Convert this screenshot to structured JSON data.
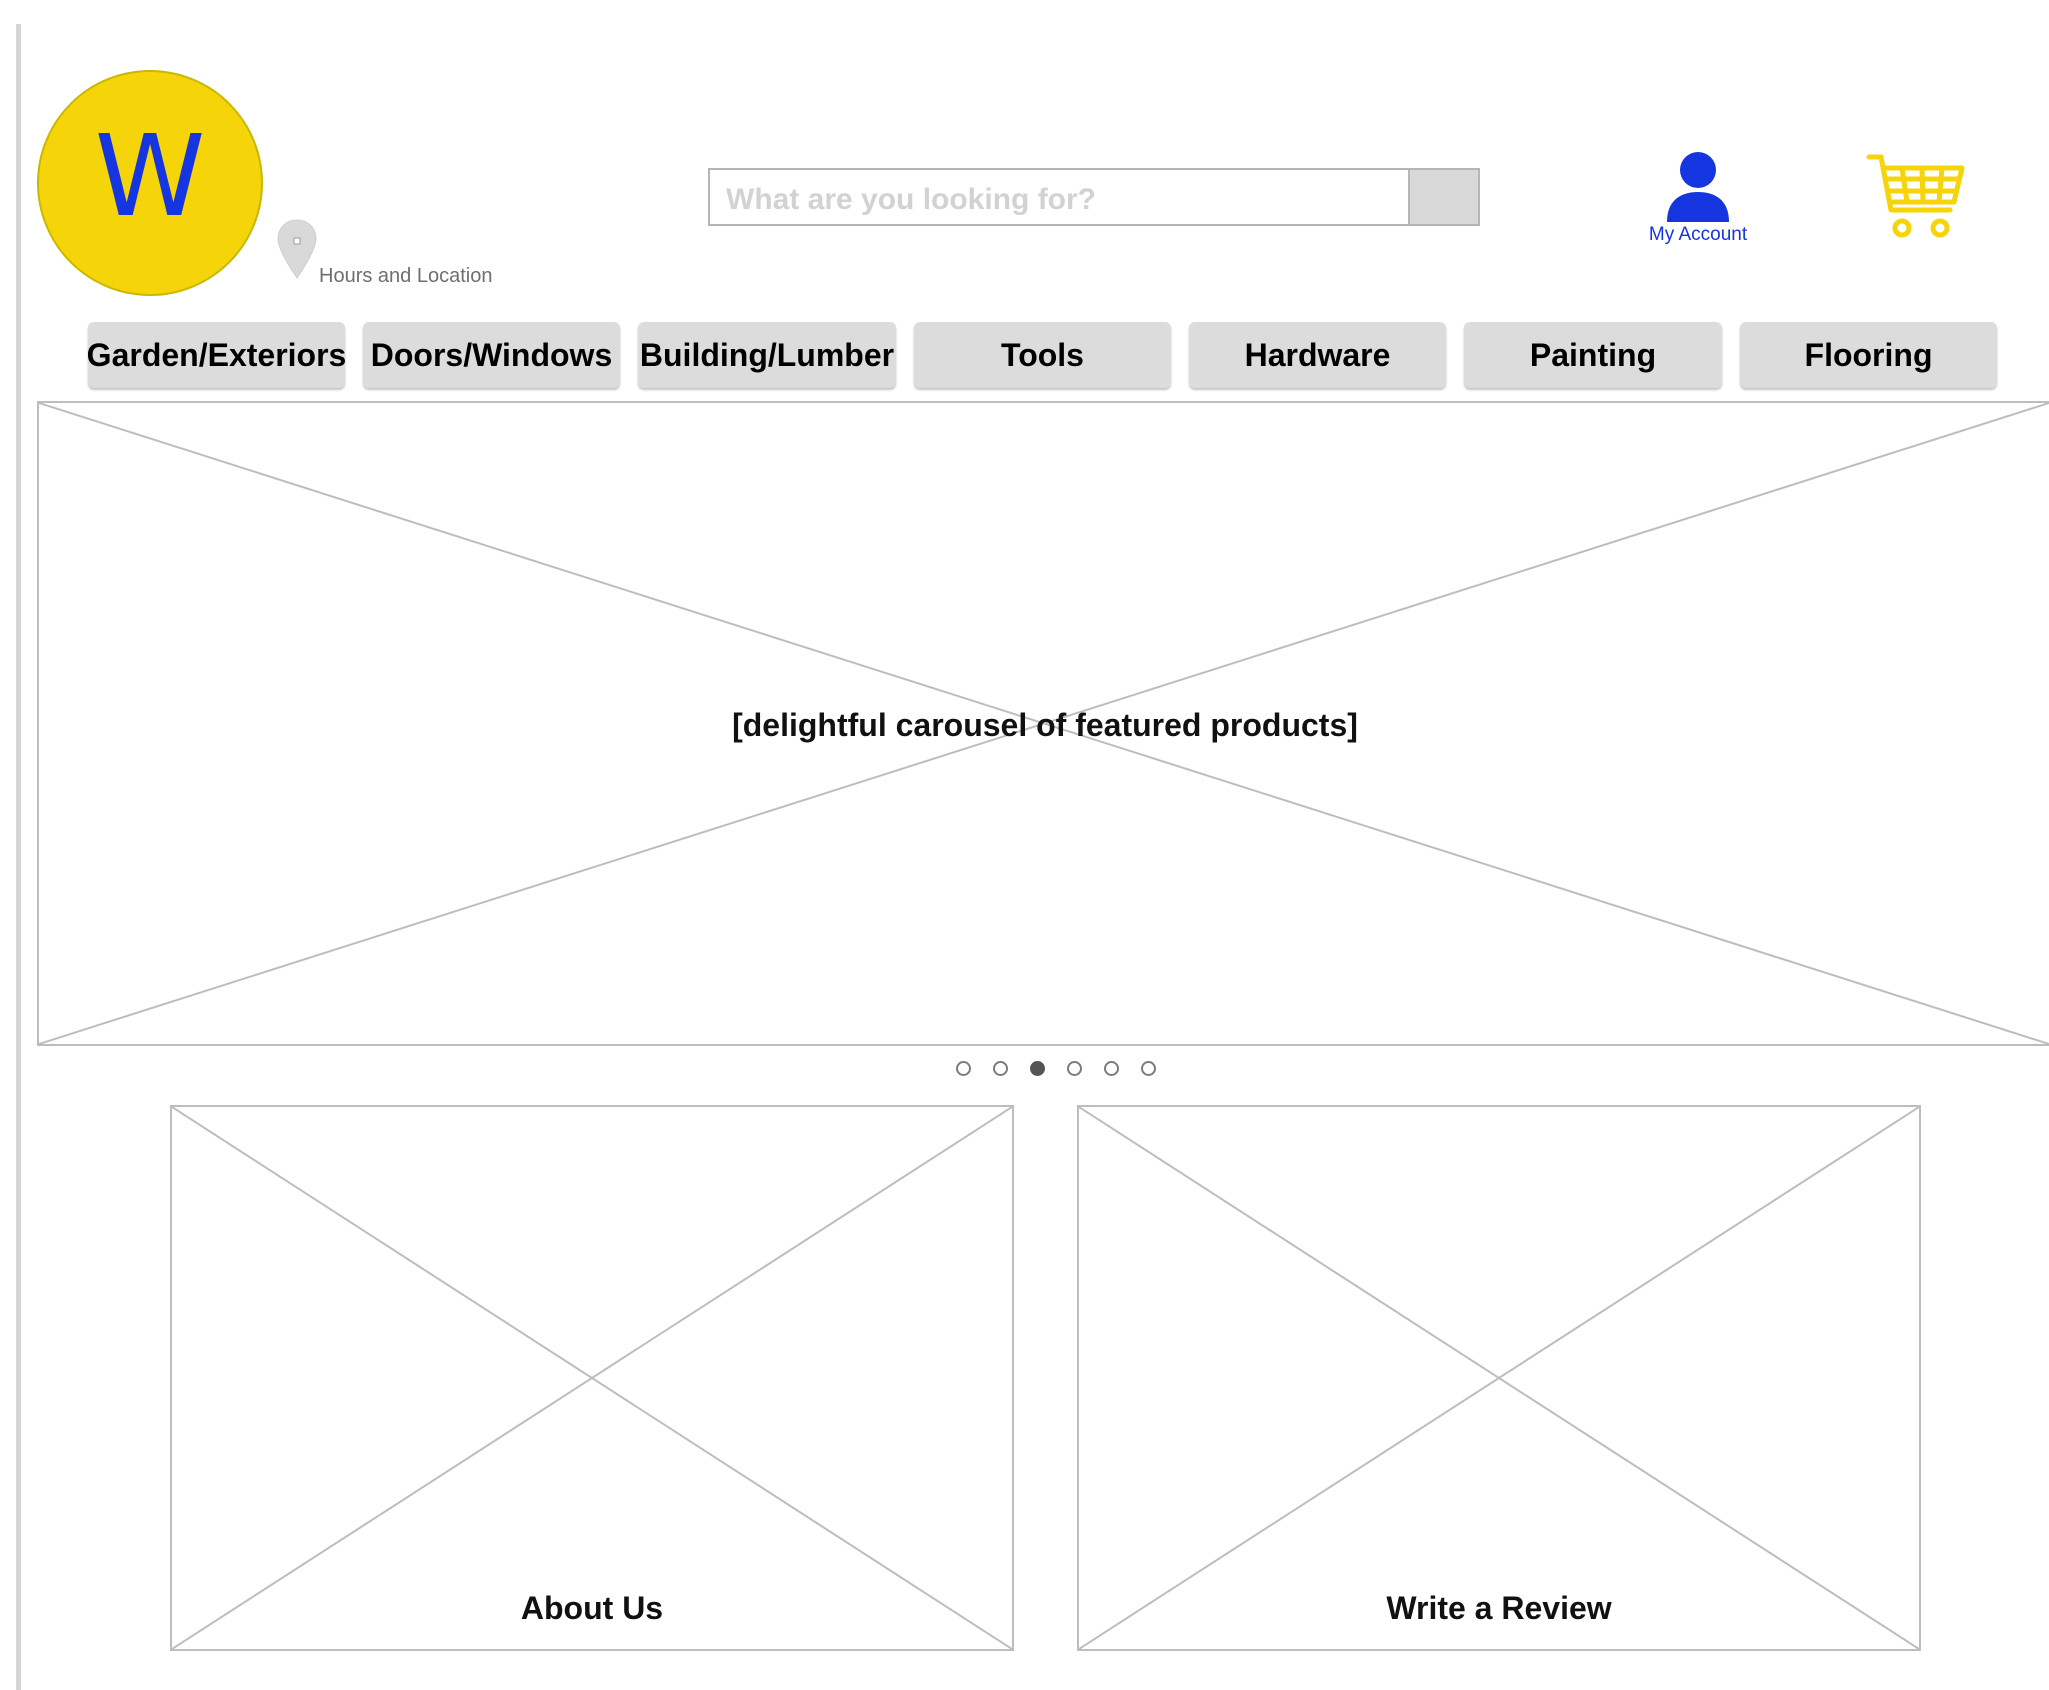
{
  "brand": {
    "logo_letter": "W",
    "logo_bg_color": "#f5d50a",
    "logo_letter_color": "#1535e0"
  },
  "location": {
    "icon": "map-pin-icon",
    "label": "Hours and Location"
  },
  "search": {
    "placeholder": "What are you looking for?",
    "value": ""
  },
  "account": {
    "icon": "user-icon",
    "label": "My Account",
    "color": "#1535e0"
  },
  "cart": {
    "icon": "shopping-cart-icon",
    "color": "#f5d50a"
  },
  "nav": {
    "tabs": [
      {
        "label": "Garden/Exteriors"
      },
      {
        "label": "Doors/Windows"
      },
      {
        "label": "Building/Lumber"
      },
      {
        "label": "Tools"
      },
      {
        "label": "Hardware"
      },
      {
        "label": "Painting"
      },
      {
        "label": "Flooring"
      }
    ]
  },
  "hero": {
    "caption": "[delightful carousel of featured products]",
    "slide_count": 6,
    "active_slide": 3
  },
  "cards": [
    {
      "label": "About Us"
    },
    {
      "label": "Write a Review"
    }
  ]
}
